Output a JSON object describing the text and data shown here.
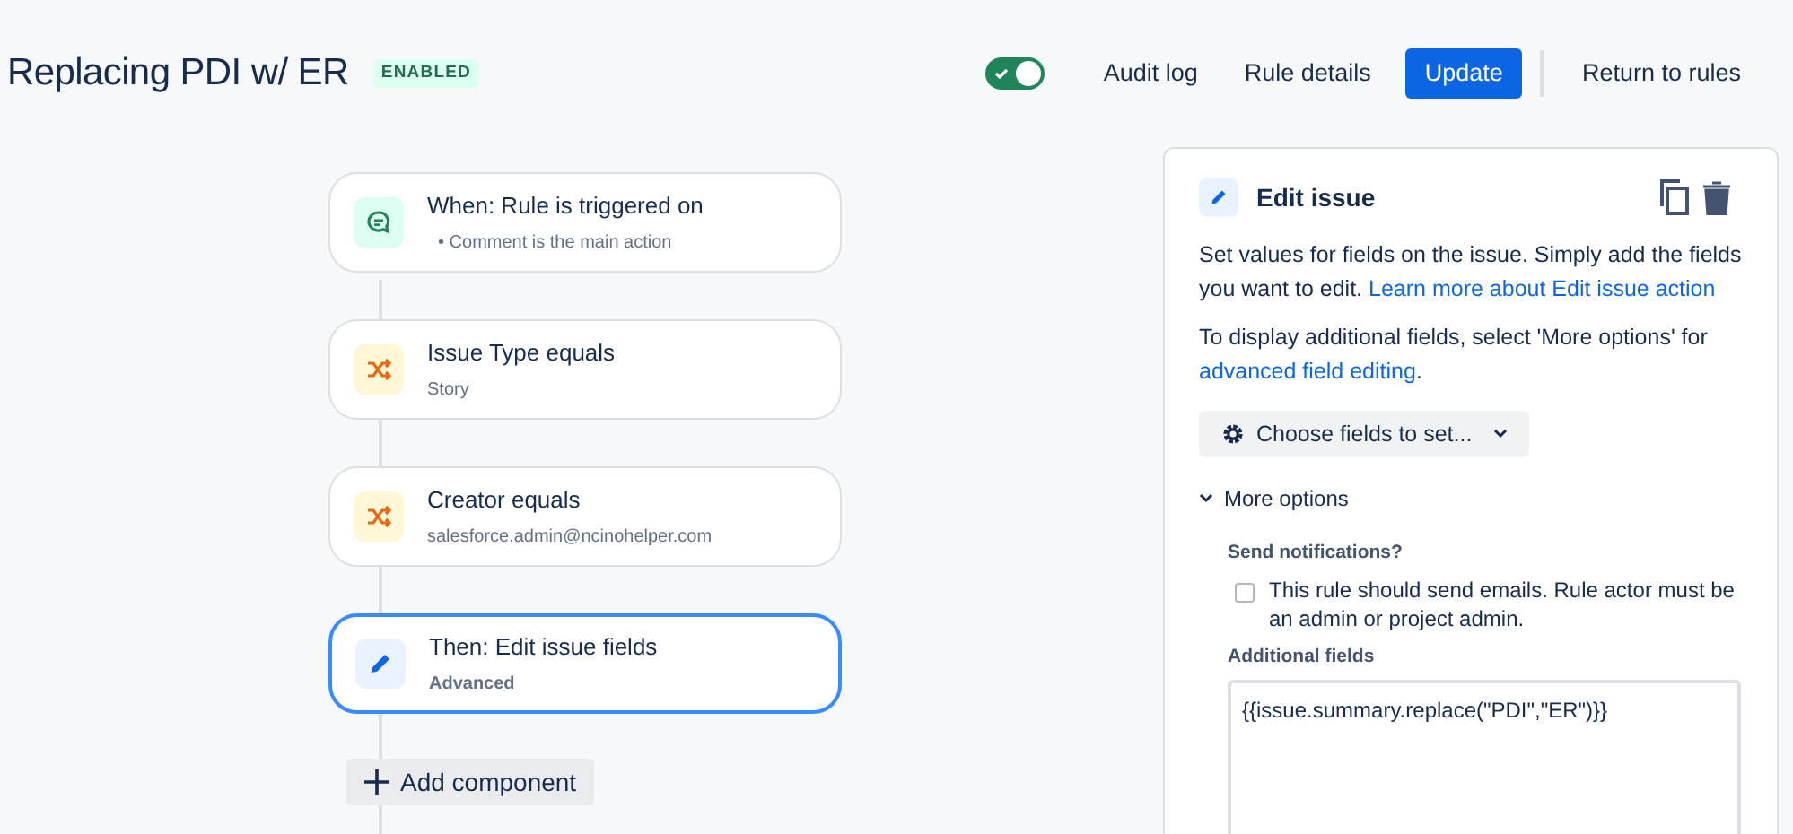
{
  "header": {
    "title": "Replacing PDI w/ ER",
    "status": "ENABLED",
    "toggle": {
      "on": true
    },
    "buttons": [
      {
        "label": "Audit log",
        "kind": "subtle"
      },
      {
        "label": "Rule details",
        "kind": "subtle"
      },
      {
        "label": "Update",
        "kind": "primary"
      },
      {
        "label": "Return to rules",
        "kind": "subtle"
      }
    ]
  },
  "steps": [
    {
      "kind": "trigger",
      "title": "When: Rule is triggered on",
      "bullet": "•",
      "detail": "Comment is the main action",
      "selected": false
    },
    {
      "kind": "condition",
      "title": "Issue Type equals",
      "detail": "Story",
      "selected": false
    },
    {
      "kind": "condition",
      "title": "Creator equals",
      "detail": "salesforce.admin@ncinohelper.com",
      "selected": false
    },
    {
      "kind": "action",
      "title": "Then: Edit issue fields",
      "detail": "Advanced",
      "selected": true
    }
  ],
  "add_button": "Add component",
  "panel": {
    "title": "Edit issue",
    "paragraphs": [
      {
        "text": "Set values for fields on the issue. Simply add the fields you want to edit.",
        "link": "Learn more about Edit issue action"
      },
      {
        "text": "To display additional fields, select 'More options' for",
        "link": "advanced field editing",
        "after": "."
      }
    ],
    "choose_button": "Choose fields to set...",
    "more_options": {
      "label": "More options",
      "expanded": true
    },
    "notify_label": "Send notifications?",
    "notify_checkbox": {
      "label": "This rule should send emails. Rule actor must be an admin or project admin.",
      "checked": false
    },
    "additional_label": "Additional fields",
    "additional_value": "{{issue.summary.replace(\"PDI\",\"ER\")}}"
  }
}
